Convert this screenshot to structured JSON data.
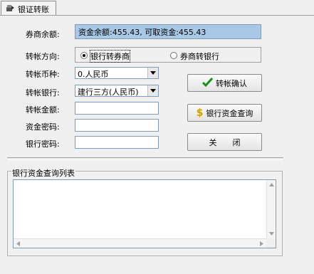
{
  "tab": {
    "label": "银证转账",
    "icon": "transfer-icon"
  },
  "status": {
    "label": "券商余额:",
    "text": "资金余额:455.43,  可取资金:455.43",
    "color": "#a9c8e6"
  },
  "direction": {
    "label": "转帐方向:",
    "options": [
      {
        "label": "银行转券商",
        "selected": true
      },
      {
        "label": "券商转银行",
        "selected": false
      }
    ]
  },
  "currency": {
    "label": "转帐币种:",
    "value": "0.人民币"
  },
  "bank": {
    "label": "转帐银行:",
    "value": "建行三方(人民币)"
  },
  "amount": {
    "label": "转帐金额:",
    "value": ""
  },
  "fund_password": {
    "label": "资金密码:",
    "value": ""
  },
  "bank_password": {
    "label": "银行密码:",
    "value": ""
  },
  "buttons": {
    "confirm": "转帐确认",
    "query": "银行资金查询",
    "close": "关　　闭"
  },
  "list": {
    "title": "银行资金查询列表",
    "rows": []
  },
  "colors": {
    "check": "#1a8f1a",
    "dollar": "#d4a000"
  }
}
